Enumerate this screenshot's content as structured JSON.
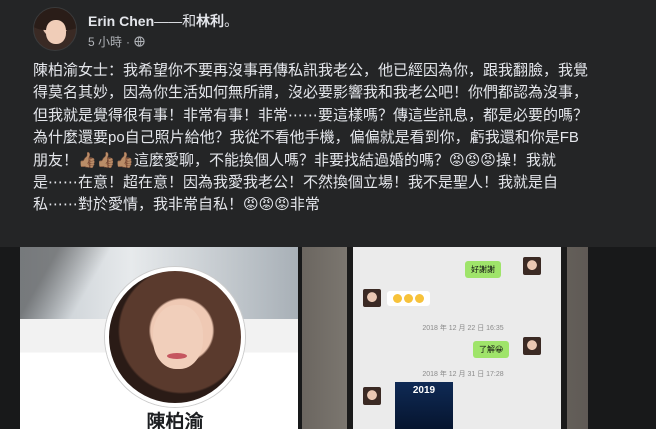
{
  "post": {
    "author": "Erin Chen",
    "separator": "——",
    "with_text": "和",
    "tagged": "林利",
    "tagged_suffix": "。",
    "time": "5 小時",
    "dot": "·",
    "privacy_icon": "globe-icon",
    "text": "陳柏渝女士：我希望你不要再沒事再傳私訊我老公，他已經因為你，跟我翻臉，我覺得莫名其妙，因為你生活如何無所謂，沒必要影響我和我老公吧！你們都認為沒事，但我就是覺得很有事！非常有事！非常⋯⋯要這樣嗎？傳這些訊息，都是必要的嗎？為什麼還要po自己照片給他？我從不看他手機，偏偏就是看到你，虧我還和你是FB朋友！👍🏽👍🏽👍🏽這麼愛聊，不能換個人嗎？非要找結過婚的嗎？😡😡😡操！我就是⋯⋯在意！超在意！因為我愛我老公！不然換個立場！我不是聖人！我就是自私⋯⋯對於愛情，我非常自私！😡😡😡非常"
  },
  "photo_left": {
    "profile_name": "陳柏渝"
  },
  "photo_right": {
    "reply_1": "好謝謝",
    "timestamp_1": "2018 年 12 月 22 日  16:35",
    "reply_2": "了解😀",
    "timestamp_2": "2018 年 12 月 31 日  17:28",
    "image_caption": "2019"
  },
  "colors": {
    "background": "#242526",
    "text": "#e4e6eb",
    "muted": "#b0b3b8",
    "chat_green": "#9fe46a"
  }
}
